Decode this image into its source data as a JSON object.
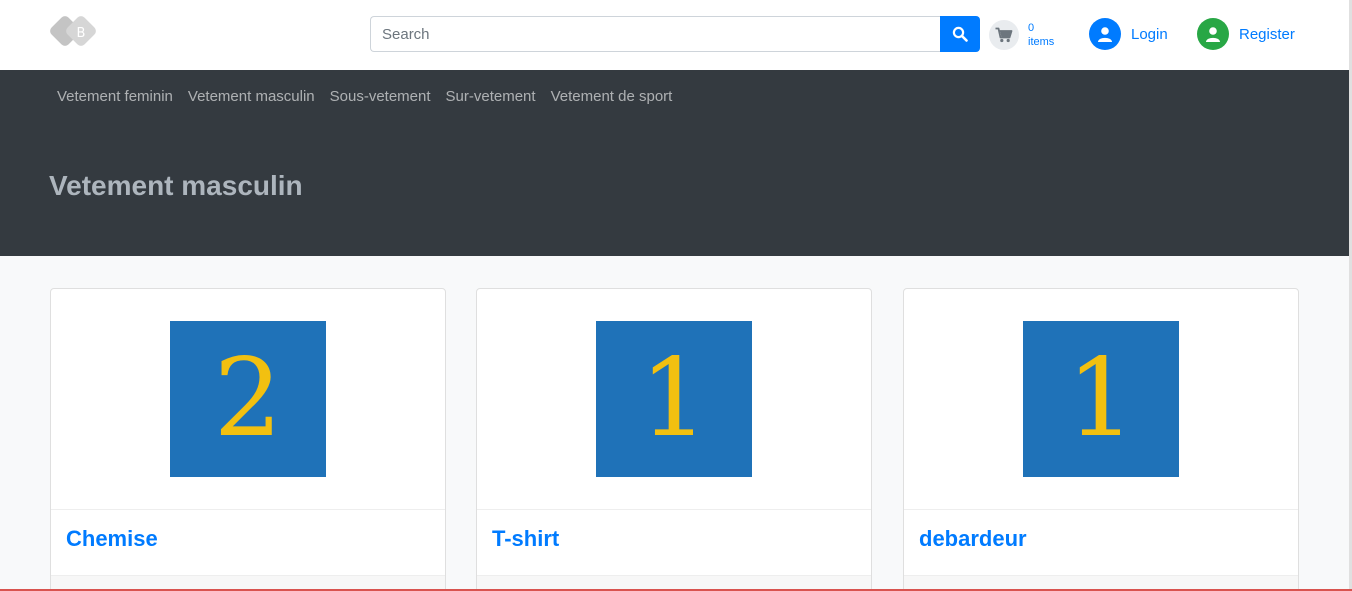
{
  "header": {
    "logo_icon": "brand-logo-icon",
    "search": {
      "placeholder": "Search",
      "value": ""
    },
    "search_icon": "search-icon",
    "cart": {
      "icon": "cart-icon",
      "count": "0",
      "count_label": "items"
    },
    "login": {
      "icon": "user-icon",
      "label": "Login"
    },
    "register": {
      "icon": "user-icon",
      "label": "Register"
    }
  },
  "nav": {
    "categories": [
      {
        "label": "Vetement feminin"
      },
      {
        "label": "Vetement masculin"
      },
      {
        "label": "Sous-vetement"
      },
      {
        "label": "Sur-vetement"
      },
      {
        "label": "Vetement de sport"
      }
    ]
  },
  "page": {
    "title": "Vetement masculin"
  },
  "products": [
    {
      "thumb_text": "2",
      "title": "Chemise"
    },
    {
      "thumb_text": "1",
      "title": "T-shirt"
    },
    {
      "thumb_text": "1",
      "title": "debardeur"
    }
  ],
  "colors": {
    "primary": "#007bff",
    "dark_nav": "#343a40",
    "success": "#28a745",
    "thumb_bg": "#1f72b8",
    "thumb_digit": "#f2c010"
  }
}
